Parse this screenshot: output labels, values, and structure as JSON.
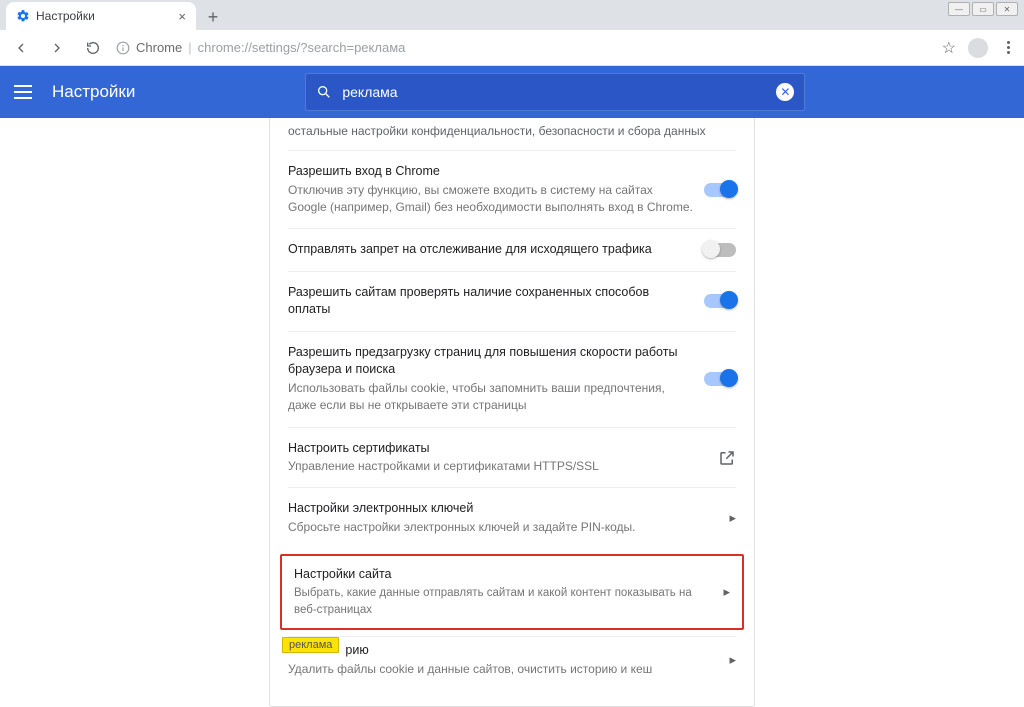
{
  "window": {
    "tab_title": "Настройки"
  },
  "addressbar": {
    "product": "Chrome",
    "url_display": "chrome://settings/?search=реклама"
  },
  "header": {
    "title": "Настройки",
    "search_value": "реклама"
  },
  "rows": {
    "cutoff": "остальные настройки конфиденциальности, безопасности и сбора данных",
    "chrome_login": {
      "title": "Разрешить вход в Chrome",
      "sub": "Отключив эту функцию, вы сможете входить в систему на сайтах Google (например, Gmail) без необходимости выполнять вход в Chrome."
    },
    "dnt": {
      "title": "Отправлять запрет на отслеживание для исходящего трафика"
    },
    "payment_check": {
      "title": "Разрешить сайтам проверять наличие сохраненных способов оплаты"
    },
    "preload": {
      "title": "Разрешить предзагрузку страниц для повышения скорости работы браузера и поиска",
      "sub": "Использовать файлы cookie, чтобы запомнить ваши предпочтения, даже если вы не открываете эти страницы"
    },
    "certs": {
      "title": "Настроить сертификаты",
      "sub": "Управление настройками и сертификатами HTTPS/SSL"
    },
    "keys": {
      "title": "Настройки электронных ключей",
      "sub": "Сбросьте настройки электронных ключей и задайте PIN-коды."
    },
    "site_settings": {
      "title": "Настройки сайта",
      "sub": "Выбрать, какие данные отправлять сайтам и какой контент показывать на веб-страницах"
    },
    "history": {
      "title_suffix": "рию",
      "sub": "Удалить файлы cookie и данные сайтов, очистить историю и кеш"
    },
    "tooltip_text": "реклама"
  }
}
